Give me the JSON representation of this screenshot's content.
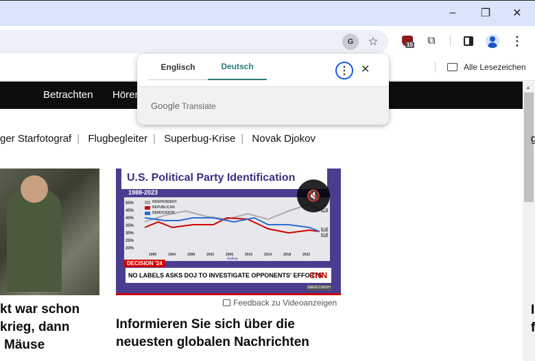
{
  "window": {
    "minimize": "–",
    "restore": "❐",
    "close": "✕"
  },
  "toolbar": {
    "extension_badge": "15"
  },
  "bookmarks": {
    "all_bookmarks": "Alle Lesezeichen"
  },
  "translate_popup": {
    "tabs": [
      "Englisch",
      "Deutsch"
    ],
    "active_tab": 1,
    "brand_google": "Google",
    "brand_translate": "Translate",
    "accent": "#2b7a78"
  },
  "nav": {
    "items": [
      "Betrachten",
      "Hören"
    ]
  },
  "trending": [
    "ger Starfotograf",
    "Flugbegleiter",
    "Superbug-Krise",
    "Novak Djokov"
  ],
  "video": {
    "chart_title": "U.S. Political Party Identification",
    "chart_subtitle": "1988-2023",
    "legend": [
      "INDEPENDENT",
      "REPUBLICAN",
      "DEMOCRATIC"
    ],
    "yticks": [
      "50%",
      "45%",
      "40%",
      "35%",
      "30%",
      "25%",
      "20%"
    ],
    "xticks": [
      "1990",
      "1994",
      "1998",
      "2002",
      "2006",
      "2010",
      "2014",
      "2018",
      "2022"
    ],
    "source": "Gallup",
    "end_labels": [
      "43",
      "27",
      "27"
    ],
    "banner_tag": "DECISION '24",
    "banner_text": "NO LABELS ASKS DOJ TO INVESTIGATE OPPONENTS' EFFORTS",
    "network": "CNN",
    "show": "SMERCONISH",
    "feedback": "Feedback zu Videoanzeigen"
  },
  "left_story": {
    "headline_lines": [
      "kt war schon",
      "krieg, dann",
      "Mäuse"
    ]
  },
  "center_story": {
    "headline": "Informieren Sie sich über die neuesten globalen Nachrichten"
  },
  "right_fragments": {
    "a": "g",
    "b": "I",
    "c": "f"
  }
}
